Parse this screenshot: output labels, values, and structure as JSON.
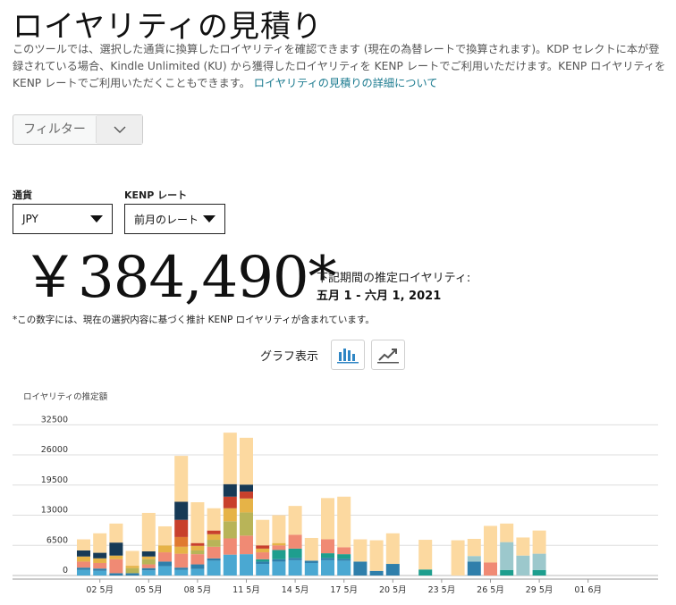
{
  "header": {
    "title": "ロイヤリティの見積り",
    "description": "このツールでは、選択した通貨に換算したロイヤリティを確認できます (現在の為替レートで換算されます)。KDP セレクトに本が登録されている場合、Kindle Unlimited (KU) から獲得したロイヤリティを KENP レートでご利用いただけます。KENP ロイヤリティを KENP レートでご利用いただくこともできます。",
    "details_link": "ロイヤリティの見積りの詳細について"
  },
  "filter": {
    "label": "フィルター"
  },
  "currency": {
    "label": "通貨",
    "value": "JPY"
  },
  "kenp_rate": {
    "label": "KENP レート",
    "value": "前月のレート"
  },
  "estimate": {
    "amount": "￥384,490*",
    "period_label": "下記期間の推定ロイヤリティ:",
    "period": "五月 1 - 六月 1, 2021",
    "note": "*この数字には、現在の選択内容に基づく推計 KENP ロイヤリティが含まれています。"
  },
  "graph_toggle": {
    "label": "グラフ表示",
    "active": "bar"
  },
  "colors": {
    "light_blue": "#4aa8d2",
    "steel_blue": "#2f7fab",
    "teal": "#1e9e8e",
    "salmon": "#f08a74",
    "pale_teal": "#9cc8cc",
    "olive": "#b8b458",
    "gold": "#e6b347",
    "orange": "#e07a31",
    "red": "#c8402c",
    "navy": "#173a56",
    "peach": "#fcd9a0"
  },
  "chart_data": {
    "type": "bar",
    "stacked": true,
    "ylabel": "ロイヤリティの推定額",
    "yticks": [
      0,
      6500,
      13000,
      19500,
      26000,
      32500
    ],
    "ylim": [
      0,
      33000
    ],
    "grid": true,
    "days": [
      1,
      2,
      3,
      4,
      5,
      6,
      7,
      8,
      9,
      10,
      11,
      12,
      13,
      14,
      15,
      16,
      17,
      18,
      19,
      20,
      21,
      22,
      23,
      24,
      25,
      26,
      27,
      28,
      29,
      30,
      31,
      32
    ],
    "xticks": [
      {
        "day": 2,
        "label": "02 5月"
      },
      {
        "day": 5,
        "label": "05 5月"
      },
      {
        "day": 8,
        "label": "08 5月"
      },
      {
        "day": 11,
        "label": "11 5月"
      },
      {
        "day": 14,
        "label": "14 5月"
      },
      {
        "day": 17,
        "label": "17 5月"
      },
      {
        "day": 20,
        "label": "20 5月"
      },
      {
        "day": 23,
        "label": "23 5月"
      },
      {
        "day": 26,
        "label": "26 5月"
      },
      {
        "day": 29,
        "label": "29 5月"
      },
      {
        "day": 32,
        "label": "01 6月"
      }
    ],
    "series": [
      {
        "color": "light_blue",
        "values": [
          1200,
          1000,
          0,
          0,
          1100,
          2000,
          1200,
          1400,
          3200,
          4500,
          4600,
          2500,
          3000,
          3300,
          2700,
          3300,
          3200,
          0,
          0,
          0,
          0,
          0,
          0,
          0,
          0,
          0,
          0,
          0,
          0,
          0,
          0,
          0
        ]
      },
      {
        "color": "steel_blue",
        "values": [
          500,
          500,
          500,
          500,
          500,
          1000,
          500,
          1000,
          500,
          0,
          0,
          500,
          500,
          500,
          500,
          500,
          400,
          3000,
          1000,
          2500,
          0,
          0,
          0,
          0,
          3000,
          0,
          0,
          0,
          0,
          0,
          0,
          0
        ]
      },
      {
        "color": "teal",
        "values": [
          0,
          0,
          0,
          0,
          0,
          0,
          0,
          0,
          0,
          0,
          0,
          500,
          2000,
          2000,
          0,
          1000,
          1000,
          0,
          0,
          0,
          0,
          1300,
          0,
          0,
          0,
          0,
          1200,
          0,
          1200,
          0,
          0,
          0
        ]
      },
      {
        "color": "salmon",
        "values": [
          1300,
          1200,
          3000,
          0,
          800,
          2000,
          3000,
          2200,
          2500,
          3500,
          4000,
          1500,
          1000,
          3000,
          0,
          3000,
          1500,
          0,
          0,
          0,
          0,
          0,
          0,
          0,
          0,
          2800,
          0,
          0,
          0,
          0,
          0,
          0
        ]
      },
      {
        "color": "pale_teal",
        "values": [
          0,
          0,
          0,
          0,
          0,
          0,
          0,
          0,
          0,
          0,
          0,
          0,
          0,
          0,
          0,
          0,
          0,
          0,
          0,
          0,
          0,
          0,
          0,
          0,
          1200,
          0,
          6000,
          4300,
          3500,
          0,
          0,
          0
        ]
      },
      {
        "color": "olive",
        "values": [
          0,
          0,
          0,
          1100,
          1100,
          0,
          0,
          800,
          1500,
          3700,
          5000,
          0,
          0,
          0,
          0,
          0,
          0,
          0,
          0,
          0,
          0,
          0,
          0,
          0,
          0,
          0,
          0,
          0,
          0,
          0,
          0,
          0
        ]
      },
      {
        "color": "gold",
        "values": [
          1100,
          1000,
          800,
          500,
          600,
          1500,
          1500,
          1000,
          1200,
          2800,
          3000,
          800,
          500,
          0,
          0,
          0,
          0,
          0,
          0,
          0,
          0,
          0,
          0,
          0,
          0,
          0,
          0,
          0,
          0,
          0,
          0,
          0
        ]
      },
      {
        "color": "orange",
        "values": [
          0,
          0,
          0,
          0,
          0,
          0,
          2100,
          0,
          0,
          0,
          0,
          0,
          0,
          0,
          0,
          0,
          0,
          0,
          0,
          0,
          0,
          0,
          0,
          0,
          0,
          0,
          0,
          0,
          0,
          0,
          0,
          0
        ]
      },
      {
        "color": "red",
        "values": [
          0,
          0,
          0,
          0,
          0,
          0,
          3700,
          600,
          800,
          2500,
          1500,
          700,
          0,
          0,
          0,
          0,
          0,
          0,
          0,
          0,
          0,
          0,
          0,
          0,
          0,
          0,
          0,
          0,
          0,
          0,
          0,
          0
        ]
      },
      {
        "color": "navy",
        "values": [
          1300,
          1200,
          2800,
          0,
          1100,
          0,
          3900,
          0,
          0,
          2700,
          1500,
          0,
          0,
          0,
          0,
          0,
          0,
          0,
          0,
          0,
          0,
          0,
          0,
          0,
          0,
          0,
          0,
          0,
          0,
          0,
          0,
          0
        ]
      },
      {
        "color": "peach",
        "values": [
          2400,
          4200,
          4100,
          3200,
          8300,
          4100,
          9900,
          8800,
          4800,
          11100,
          10100,
          5500,
          6000,
          6200,
          4900,
          8900,
          10900,
          4800,
          6600,
          6600,
          0,
          6400,
          0,
          7600,
          3700,
          7900,
          4000,
          3900,
          5000,
          0,
          0,
          0
        ]
      }
    ]
  }
}
